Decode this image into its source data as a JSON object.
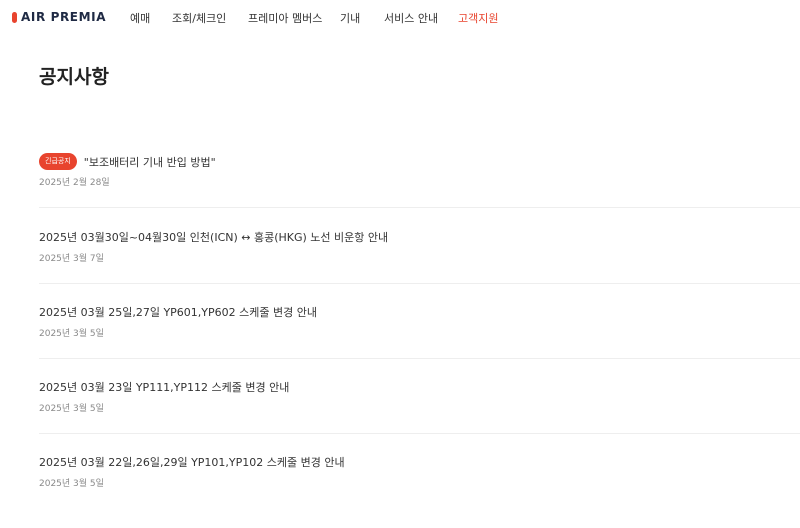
{
  "header": {
    "logo_text": "AIR PREMIA",
    "logo_mark_icon": "logo-mark-icon",
    "nav": [
      {
        "label": "예매"
      },
      {
        "label": "조회/체크인"
      },
      {
        "label": "프레미아 멤버스"
      },
      {
        "label": "기내"
      },
      {
        "label": "서비스 안내"
      },
      {
        "label": "고객지원",
        "active": true
      }
    ]
  },
  "page": {
    "title": "공지사항"
  },
  "notices": [
    {
      "badge": "긴급공지",
      "title": "\"보조배터리 기내 반입 방법\"",
      "date": "2025년 2월 28일"
    },
    {
      "title": "2025년 03월30일~04월30일 인천(ICN) ↔ 홍콩(HKG) 노선 비운항 안내",
      "date": "2025년 3월 7일"
    },
    {
      "title": "2025년 03월 25일,27일 YP601,YP602 스케줄 변경 안내",
      "date": "2025년 3월 5일"
    },
    {
      "title": "2025년 03월 23일 YP111,YP112 스케줄 변경 안내",
      "date": "2025년 3월 5일"
    },
    {
      "title": "2025년 03월 22일,26일,29일 YP101,YP102 스케줄 변경 안내",
      "date": "2025년 3월 5일"
    }
  ],
  "colors": {
    "accent": "#e8442e",
    "text": "#222222",
    "muted": "#8a8a8a",
    "divider": "#eeeeee"
  }
}
